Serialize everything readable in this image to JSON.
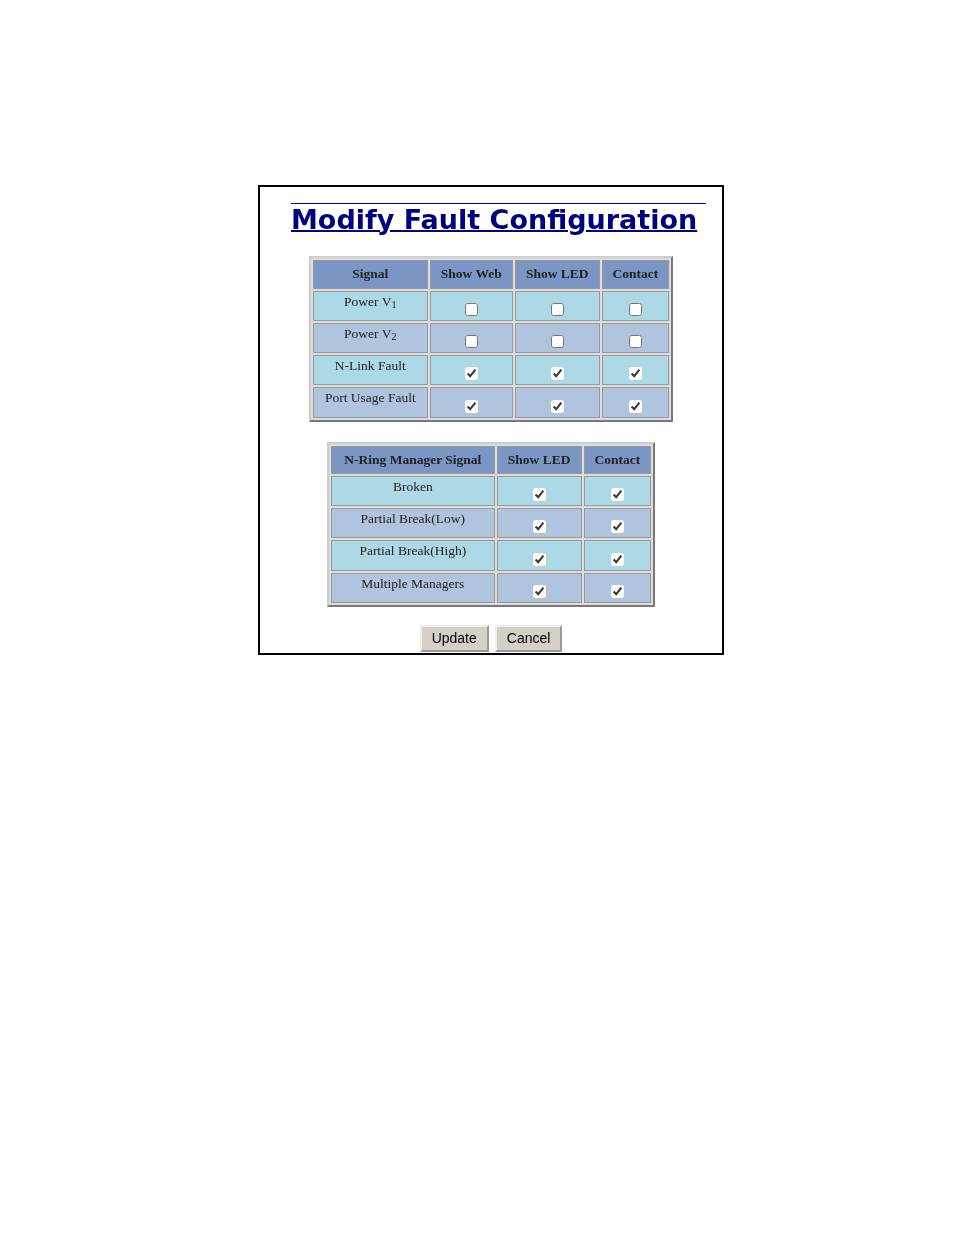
{
  "title": "Modify Fault Configuration",
  "fault_table": {
    "columns": [
      "Signal",
      "Show Web",
      "Show LED",
      "Contact"
    ],
    "rows": [
      {
        "signal": "Power V$_{1}$",
        "show_web": false,
        "show_led": false,
        "contact": false
      },
      {
        "signal": "Power V$_{2}$",
        "show_web": false,
        "show_led": false,
        "contact": false
      },
      {
        "signal": "N-Link Fault",
        "show_web": true,
        "show_led": true,
        "contact": true
      },
      {
        "signal": "Port Usage Fault",
        "show_web": true,
        "show_led": true,
        "contact": true
      }
    ]
  },
  "ring_table": {
    "columns": [
      "N-Ring Manager Signal",
      "Show LED",
      "Contact"
    ],
    "rows": [
      {
        "signal": "Broken",
        "show_led": true,
        "contact": true
      },
      {
        "signal": "Partial Break(Low)",
        "show_led": true,
        "contact": true
      },
      {
        "signal": "Partial Break(High)",
        "show_led": true,
        "contact": true
      },
      {
        "signal": "Multiple Managers",
        "show_led": true,
        "contact": true
      }
    ]
  },
  "buttons": [
    "Update",
    "Cancel"
  ]
}
